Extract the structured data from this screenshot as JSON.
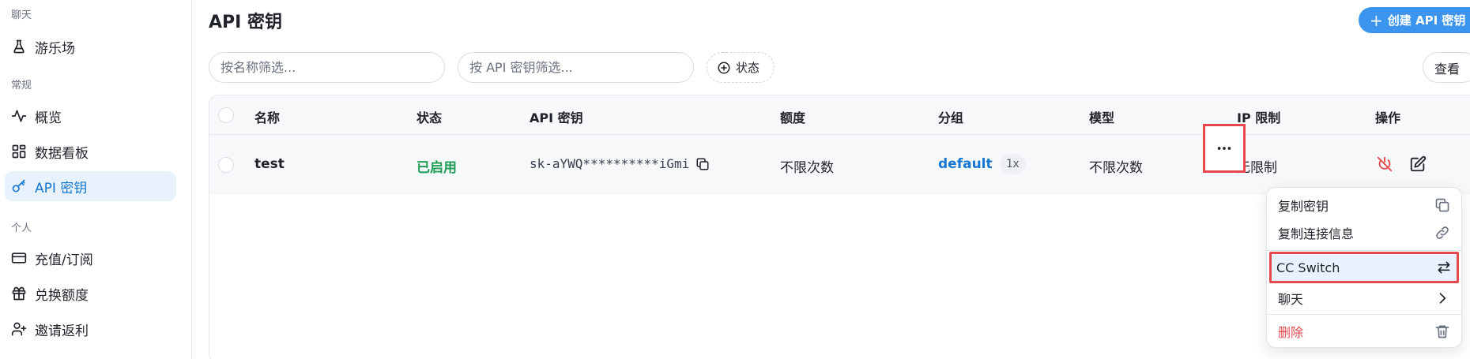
{
  "sidebar": {
    "sections": [
      {
        "label": "聊天",
        "items": [
          {
            "label": "游乐场",
            "icon": "flask-icon"
          }
        ]
      },
      {
        "label": "常规",
        "items": [
          {
            "label": "概览",
            "icon": "activity-icon"
          },
          {
            "label": "数据看板",
            "icon": "dashboard-icon"
          },
          {
            "label": "API 密钥",
            "icon": "key-icon",
            "active": true
          }
        ]
      },
      {
        "label": "个人",
        "items": [
          {
            "label": "充值/订阅",
            "icon": "credit-card-icon"
          },
          {
            "label": "兑换额度",
            "icon": "gift-icon"
          },
          {
            "label": "邀请返利",
            "icon": "user-plus-icon"
          }
        ]
      }
    ]
  },
  "header": {
    "title": "API 密钥",
    "create_label": "创建 API 密钥"
  },
  "filters": {
    "name_placeholder": "按名称筛选...",
    "key_placeholder": "按 API 密钥筛选...",
    "status_label": "状态",
    "view_label": "查看"
  },
  "table": {
    "columns": [
      "名称",
      "状态",
      "API 密钥",
      "额度",
      "分组",
      "模型",
      "IP 限制",
      "操作"
    ],
    "rows": [
      {
        "name": "test",
        "status": "已启用",
        "key": "sk-aYWQ**********iGmi",
        "quota": "不限次数",
        "group": "default",
        "ratio": "1x",
        "models": "不限次数",
        "ip_limit": "无限制"
      }
    ]
  },
  "menu": {
    "items": [
      {
        "label": "复制密钥",
        "icon": "copy-icon"
      },
      {
        "label": "复制连接信息",
        "icon": "link-icon"
      },
      {
        "label": "CC Switch",
        "icon": "switch-arrows-icon",
        "highlighted": true
      },
      {
        "label": "聊天",
        "icon": "chevron-right-icon"
      },
      {
        "label": "删除",
        "icon": "trash-icon",
        "danger": true
      }
    ]
  },
  "colors": {
    "accent": "#1677d2",
    "primary_button": "#3b95ee",
    "enabled": "#1f9d55",
    "danger": "#e5484d",
    "highlight_border": "#e5484d"
  }
}
